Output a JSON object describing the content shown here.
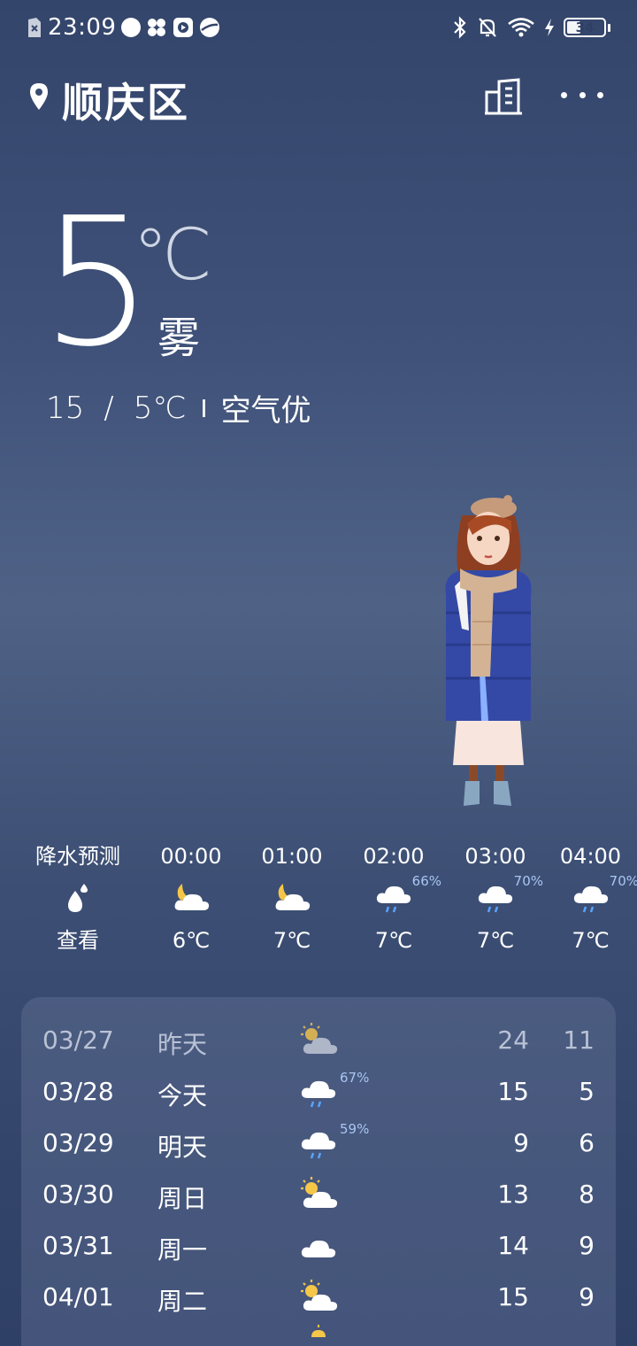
{
  "status_bar": {
    "time": "23:09",
    "battery": "34"
  },
  "header": {
    "city": "顺庆区"
  },
  "current": {
    "temp": "5",
    "unit": "℃",
    "condition": "雾",
    "high": "15",
    "range_sep": "/",
    "low": "5℃",
    "aqi": "空气优"
  },
  "hourly": [
    {
      "time": "降水预测",
      "icon": "raindrop-icon",
      "temp": "查看",
      "pop": ""
    },
    {
      "time": "00:00",
      "icon": "moon-cloud-icon",
      "temp": "6℃",
      "pop": ""
    },
    {
      "time": "01:00",
      "icon": "moon-cloud-icon",
      "temp": "7℃",
      "pop": ""
    },
    {
      "time": "02:00",
      "icon": "rain-cloud-icon",
      "temp": "7℃",
      "pop": "66%"
    },
    {
      "time": "03:00",
      "icon": "rain-cloud-icon",
      "temp": "7℃",
      "pop": "70%"
    },
    {
      "time": "04:00",
      "icon": "rain-cloud-icon",
      "temp": "7℃",
      "pop": "70%"
    }
  ],
  "daily": [
    {
      "date": "03/27",
      "name": "昨天",
      "icon": "sun-cloud-icon",
      "pop": "",
      "high": "24",
      "low": "11"
    },
    {
      "date": "03/28",
      "name": "今天",
      "icon": "rain-cloud-icon",
      "pop": "67%",
      "high": "15",
      "low": "5"
    },
    {
      "date": "03/29",
      "name": "明天",
      "icon": "rain-cloud-icon",
      "pop": "59%",
      "high": "9",
      "low": "6"
    },
    {
      "date": "03/30",
      "name": "周日",
      "icon": "sun-cloud-icon",
      "pop": "",
      "high": "13",
      "low": "8"
    },
    {
      "date": "03/31",
      "name": "周一",
      "icon": "cloud-icon",
      "pop": "",
      "high": "14",
      "low": "9"
    },
    {
      "date": "04/01",
      "name": "周二",
      "icon": "sun-cloud-icon",
      "pop": "",
      "high": "15",
      "low": "9"
    }
  ]
}
